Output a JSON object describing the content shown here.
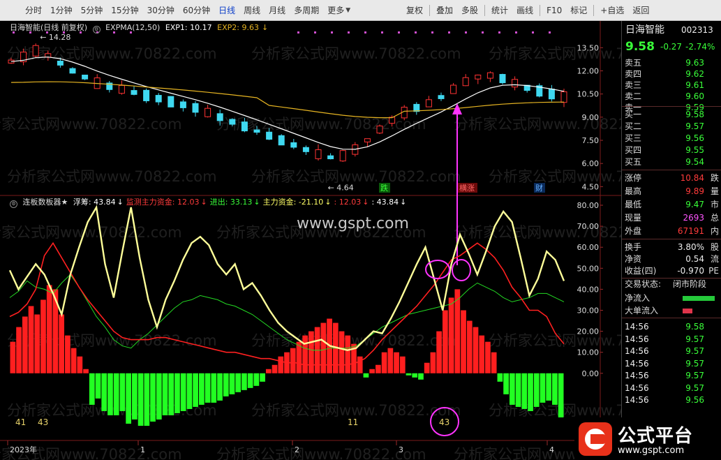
{
  "toolbar": {
    "periods": [
      "分时",
      "1分钟",
      "5分钟",
      "15分钟",
      "30分钟",
      "60分钟",
      "日线",
      "周线",
      "月线",
      "多周期",
      "更多"
    ],
    "active_period": "日线",
    "right": [
      "复权",
      "叠加",
      "多股",
      "统计",
      "画线",
      "F10",
      "标记",
      "+自选",
      "返回"
    ]
  },
  "main_legend": {
    "title": "日海智能(日线 前复权)",
    "indicator": "EXPMA(12,50)",
    "exp1": "EXP1: 10.17",
    "exp2": "EXP2: 9.63",
    "down_arrow": "↓",
    "colors": {
      "exp1": "#ffffff",
      "exp2": "#e6b422"
    }
  },
  "sub_legend": {
    "name": "连板数板器★",
    "items": [
      {
        "text": "浮筹: 43.84",
        "color": "#ffffff"
      },
      {
        "text": "监测主力资金: 12.03",
        "color": "#ff3b3b"
      },
      {
        "text": "进出: 33.13",
        "color": "#39ff39"
      },
      {
        "text": "主力资金: -21.10",
        "color": "#ffff66"
      },
      {
        "text": ": 12.03",
        "color": "#ff3b3b"
      },
      {
        "text": ": 43.84",
        "color": "#ffffff"
      }
    ],
    "arrow": "↓"
  },
  "chart_data": [
    {
      "type": "candlestick",
      "title": "日海智能(日线 前复权)",
      "y_axis_ticks": [
        "13.50",
        "12.00",
        "10.50",
        "9.00",
        "7.50",
        "6.00",
        "4.50"
      ],
      "ylim": [
        4.2,
        14.6
      ],
      "annotations": [
        {
          "text": "14.28",
          "kind": "high"
        },
        {
          "text": "4.64",
          "kind": "low"
        }
      ],
      "event_labels": [
        "跌",
        "横涨",
        "财"
      ],
      "series": [
        {
          "name": "EXP1",
          "color": "#ffffff",
          "last": 10.17
        },
        {
          "name": "EXP2",
          "color": "#e6b422",
          "last": 9.63
        }
      ],
      "trend_line": [
        12.6,
        12.9,
        13.3,
        13.0,
        12.5,
        12.0,
        11.6,
        11.2,
        11.0,
        10.8,
        10.6,
        10.4,
        10.2,
        10.0,
        9.8,
        9.6,
        9.3,
        9.0,
        8.7,
        8.4,
        8.1,
        7.8,
        7.5,
        7.2,
        6.9,
        6.6,
        6.4,
        6.5,
        6.9,
        7.5,
        8.2,
        8.8,
        9.3,
        9.6,
        9.9,
        10.3,
        10.8,
        11.3,
        11.6,
        11.7,
        11.5,
        11.2,
        10.9,
        10.7,
        10.5,
        10.3
      ]
    },
    {
      "type": "indicator",
      "title": "连板数板器★",
      "y_axis_ticks": [
        "80.00",
        "70.00",
        "60.00",
        "50.00",
        "40.00",
        "30.00",
        "20.00",
        "10.00",
        "0.00"
      ],
      "ylim": [
        -25,
        82
      ],
      "series": [
        {
          "name": "浮筹",
          "color": "#ffff99",
          "values": [
            49,
            40,
            46,
            52,
            47,
            38,
            28,
            47,
            60,
            72,
            79,
            52,
            36,
            58,
            79,
            55,
            35,
            22,
            35,
            44,
            54,
            62,
            65,
            61,
            52,
            47,
            52,
            40,
            43,
            37,
            30,
            24,
            20,
            17,
            14,
            15,
            16,
            13,
            12,
            11,
            12,
            16,
            20,
            19,
            26,
            34,
            43,
            52,
            60,
            45,
            30,
            52,
            66,
            57,
            47,
            58,
            70,
            77,
            72,
            55,
            37,
            45,
            58,
            54,
            44
          ]
        },
        {
          "name": "监测主力资金",
          "color": "#ff2020",
          "values": [
            27,
            29,
            33,
            40,
            56,
            62,
            55,
            48,
            41,
            35,
            30,
            25,
            20,
            17,
            16,
            16,
            16,
            17,
            17,
            16,
            15,
            14,
            13,
            12,
            11,
            10,
            10,
            9,
            8,
            7,
            7,
            6,
            5,
            5,
            4,
            4,
            4,
            4,
            4,
            4,
            5,
            7,
            11,
            16,
            20,
            24,
            28,
            32,
            37,
            42,
            48,
            54,
            56,
            59,
            62,
            59,
            55,
            49,
            41,
            36,
            30,
            30,
            27,
            19,
            14
          ]
        },
        {
          "name": "进出",
          "color": "#23d823",
          "values": [
            36,
            39,
            44,
            41,
            40,
            38,
            43,
            47,
            41,
            34,
            27,
            22,
            16,
            13,
            12,
            16,
            19,
            23,
            27,
            31,
            34,
            35,
            37,
            36,
            35,
            33,
            32,
            30,
            28,
            25,
            22,
            19,
            16,
            14,
            12,
            11,
            11,
            12,
            12,
            12,
            13,
            16,
            19,
            22,
            24,
            26,
            28,
            29,
            30,
            31,
            32,
            33,
            36,
            40,
            43,
            41,
            39,
            36,
            34,
            35,
            36,
            38,
            38,
            36,
            34
          ]
        },
        {
          "name": "主力资金",
          "color": "#ff1f1f_pos/#22ff22_neg",
          "values": [
            15,
            22,
            27,
            32,
            28,
            35,
            42,
            40,
            28,
            18,
            12,
            8,
            2,
            -15,
            -12,
            -18,
            -20,
            -20,
            -18,
            -24,
            -22,
            -25,
            -25,
            -23,
            -22,
            -20,
            -20,
            -19,
            -18,
            -17,
            -16,
            -15,
            -14,
            -14,
            -13,
            -11,
            -10,
            -9,
            -8,
            -7,
            -6,
            -4,
            2,
            4,
            8,
            10,
            12,
            15,
            18,
            20,
            22,
            24,
            26,
            24,
            20,
            18,
            14,
            8,
            -2,
            2,
            4,
            10,
            12,
            10,
            8,
            -1,
            -2,
            -3,
            5,
            10,
            20,
            30,
            36,
            40,
            30,
            25,
            22,
            18,
            15,
            10,
            -4,
            -10,
            -15,
            -16,
            -17,
            -18,
            -16,
            -14,
            -13,
            -15,
            -21
          ]
        }
      ],
      "markers": [
        {
          "text": "41"
        },
        {
          "text": "43"
        },
        {
          "text": "11"
        },
        {
          "text": "43"
        }
      ]
    }
  ],
  "x_axis": [
    "2023年",
    "1",
    "2",
    "3",
    "4"
  ],
  "watermarks": {
    "site": "分析家公式网www.70822.com",
    "center": "www.gspt.com"
  },
  "side": {
    "name": "日海智能",
    "code": "002313",
    "price": "9.58",
    "change": "-0.27",
    "change_pct": "-2.74%",
    "asks": [
      {
        "label": "卖五",
        "price": "9.63"
      },
      {
        "label": "卖四",
        "price": "9.62"
      },
      {
        "label": "卖三",
        "price": "9.61"
      },
      {
        "label": "卖二",
        "price": "9.60"
      },
      {
        "label": "卖一",
        "price": "9.59"
      }
    ],
    "bids": [
      {
        "label": "买一",
        "price": "9.58"
      },
      {
        "label": "买二",
        "price": "9.57"
      },
      {
        "label": "买三",
        "price": "9.56"
      },
      {
        "label": "买四",
        "price": "9.55"
      },
      {
        "label": "买五",
        "price": "9.54"
      }
    ],
    "stats": [
      {
        "label": "涨停",
        "value": "10.84",
        "color": "#ff3b3b",
        "tail": "跌"
      },
      {
        "label": "最高",
        "value": "9.89",
        "color": "#ff3b3b",
        "tail": "量"
      },
      {
        "label": "最低",
        "value": "9.47",
        "color": "#39ff39",
        "tail": "市"
      },
      {
        "label": "现量",
        "value": "2693",
        "color": "#ff55ff",
        "tail": "总"
      },
      {
        "label": "外盘",
        "value": "67191",
        "color": "#ff3b3b",
        "tail": "内"
      }
    ],
    "stats2": [
      {
        "label": "换手",
        "value": "3.80%",
        "tail": "股"
      },
      {
        "label": "净资",
        "value": "0.54",
        "tail": "流"
      },
      {
        "label": "收益(四)",
        "value": "-0.970",
        "tail": "PE"
      }
    ],
    "trade_status_label": "交易状态:",
    "trade_status": "闭市阶段",
    "flows": [
      {
        "label": "净流入",
        "color": "#25c93a"
      },
      {
        "label": "大单流入",
        "color": "#e0344a"
      }
    ],
    "ticks": [
      {
        "time": "14:56",
        "price": "9.58"
      },
      {
        "time": "14:56",
        "price": "9.57"
      },
      {
        "time": "14:56",
        "price": "9.57"
      },
      {
        "time": "14:56",
        "price": "9.57"
      },
      {
        "time": "14:56",
        "price": "9.57"
      },
      {
        "time": "14:56",
        "price": "9.57"
      },
      {
        "time": "14:56",
        "price": "9.56"
      }
    ]
  },
  "brand": {
    "title": "公式平台",
    "url": "www.gspt.com"
  }
}
